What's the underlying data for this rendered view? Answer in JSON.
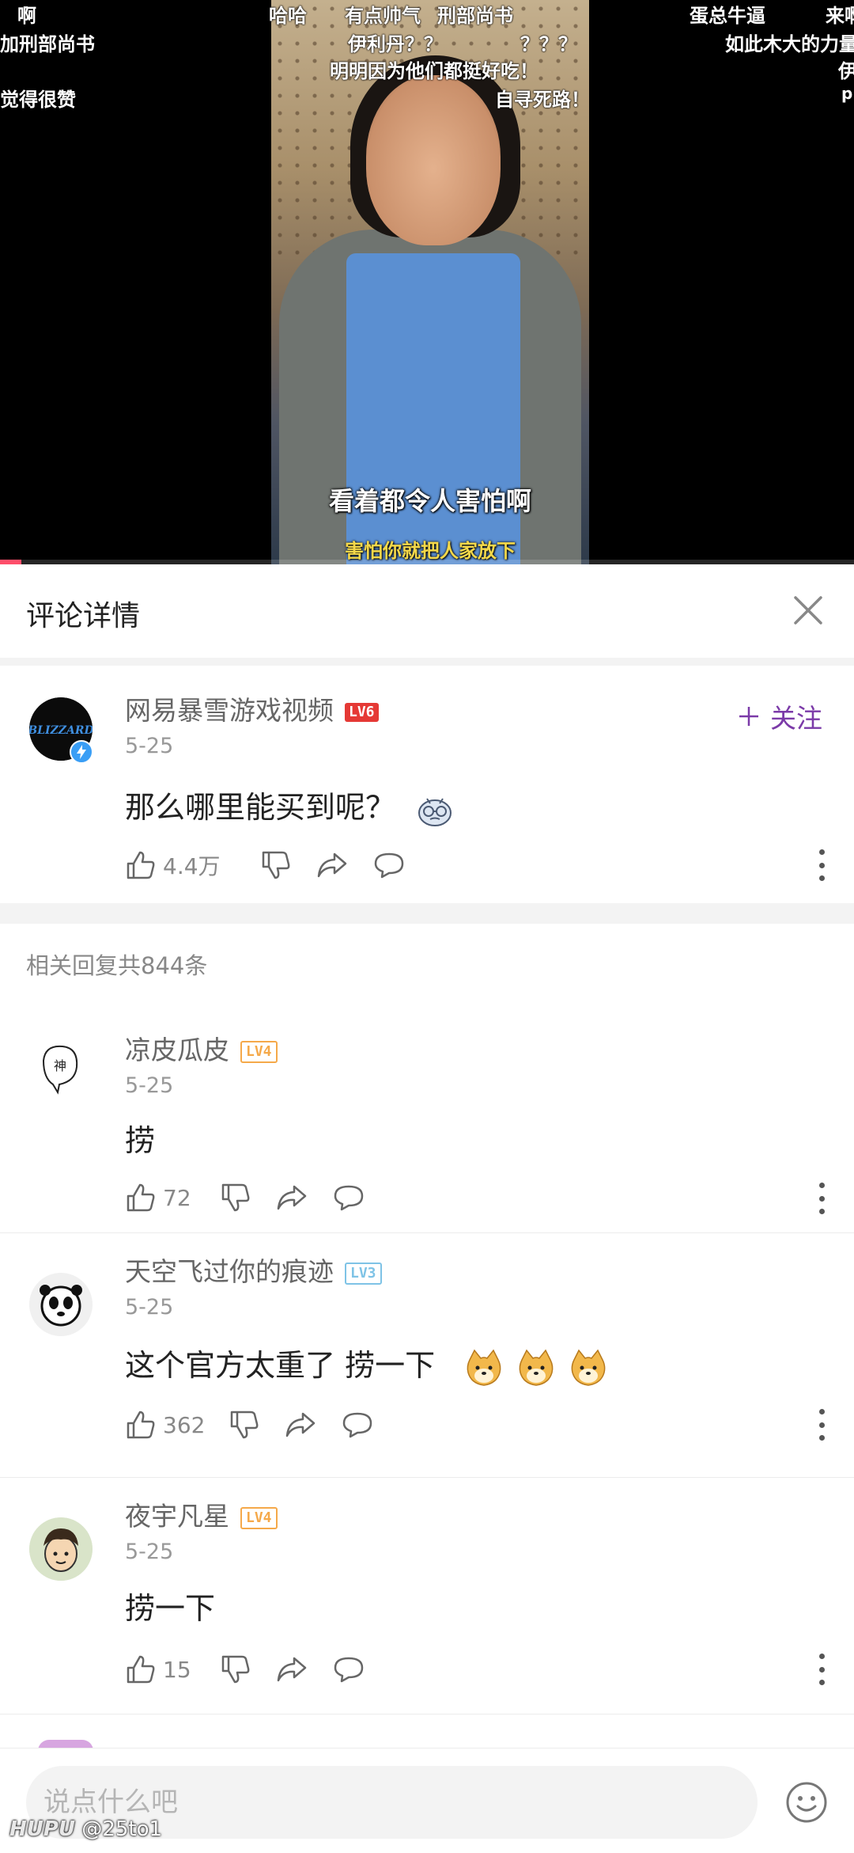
{
  "video": {
    "subtitle_main": "看着都令人害怕啊",
    "subtitle_sub": "害怕你就把人家放下",
    "progress_fraction": 0.025,
    "danmaku": [
      "啊",
      "哈哈",
      "有点帅气",
      "刑部尚书",
      "蛋总牛逼",
      "来啊",
      "加刑部尚书",
      "伊利丹？？",
      "？？？",
      "如此木大的力量",
      "明明因为他们都挺好吃！",
      "自寻死路！",
      "觉得很赞",
      "伊",
      "p"
    ]
  },
  "header": {
    "title": "评论详情",
    "close_label": "×"
  },
  "main_comment": {
    "name": "网易暴雪游戏视频",
    "level": "LV6",
    "date": "5-25",
    "text": "那么哪里能买到呢？",
    "likes": "4.4万",
    "follow_label": "关注",
    "avatar_text": "BLIZZARD"
  },
  "related_label": "相关回复共844条",
  "replies": [
    {
      "name": "凉皮瓜皮",
      "level": "LV4",
      "date": "5-25",
      "text": "捞",
      "likes": "72",
      "avatar_text": "神"
    },
    {
      "name": "天空飞过你的痕迹",
      "level": "LV3",
      "date": "5-25",
      "text": "这个官方太重了   捞一下",
      "likes": "362"
    },
    {
      "name": "夜宇凡星",
      "level": "LV4",
      "date": "5-25",
      "text": "捞一下",
      "likes": "15"
    }
  ],
  "input": {
    "placeholder": "说点什么吧"
  },
  "watermark": {
    "brand": "HUPU",
    "handle": "@25to1"
  },
  "colors": {
    "accent": "#7b3aa8",
    "lv6": "#e53935",
    "lv4": "#f5a94a",
    "lv3": "#7ec3e6"
  }
}
